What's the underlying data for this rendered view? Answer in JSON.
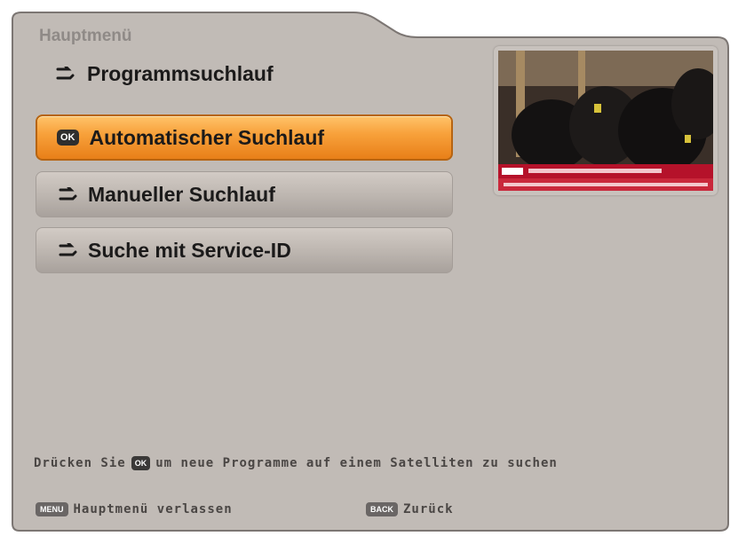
{
  "header": {
    "breadcrumb": "Hauptmenü",
    "title": "Programmsuchlauf",
    "title_icon": "arrow-icon"
  },
  "menu": {
    "items": [
      {
        "label": "Automatischer Suchlauf",
        "key": "OK",
        "state": "selected"
      },
      {
        "label": "Manueller Suchlauf",
        "icon": "arrow-icon",
        "state": "normal"
      },
      {
        "label": "Suche mit Service-ID",
        "icon": "arrow-icon",
        "state": "normal"
      }
    ]
  },
  "hint": {
    "before": "Drücken Sie",
    "key": "OK",
    "after": "um neue Programme auf einem Satelliten zu suchen"
  },
  "footer": {
    "menu_key": "MENU",
    "menu_label": "Hauptmenü verlassen",
    "back_key": "BACK",
    "back_label": "Zurück"
  },
  "colors": {
    "panel": "#c1bbb6",
    "selected_accent": "#f39a35",
    "ticker": "#b5122a"
  }
}
